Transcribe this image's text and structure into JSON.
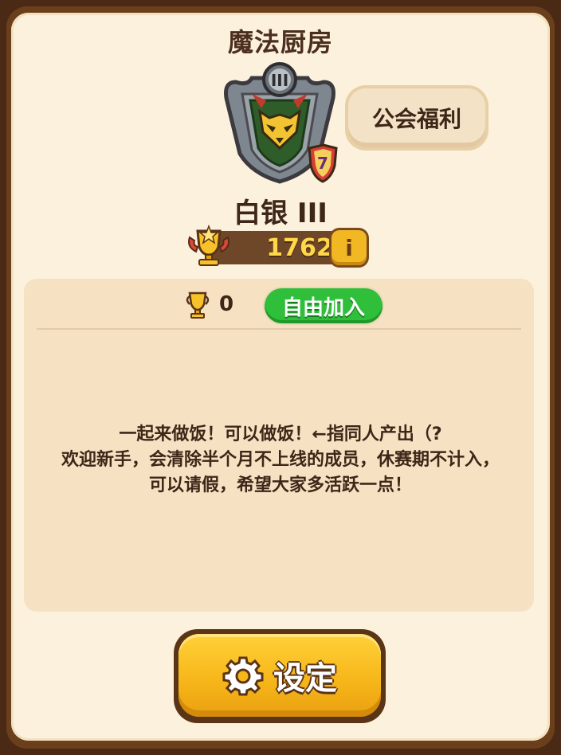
{
  "guild": {
    "name": "魔法厨房",
    "tier_roman": "III",
    "level_badge": "7",
    "rank_label": "白银 III",
    "trophies": "1762",
    "info_label": "i",
    "benefits_button": "公会福利"
  },
  "requirements": {
    "min_trophies": "0",
    "join_mode": "自由加入"
  },
  "description": "一起来做饭！可以做饭！←指同人产出（?\n欢迎新手，会清除半个月不上线的成员，休赛期不计入，\n可以请假，希望大家多活跃一点！",
  "settings_button": "设定",
  "colors": {
    "panel_bg": "#fbf1dd",
    "join_green": "#2fbf3a",
    "settings_yellow": "#f7b71a",
    "trophy_text": "#ffd84a"
  },
  "icons": {
    "emblem": "guild-emblem-icon",
    "trophy": "trophy-icon",
    "gear": "gear-icon",
    "info": "info-icon"
  }
}
